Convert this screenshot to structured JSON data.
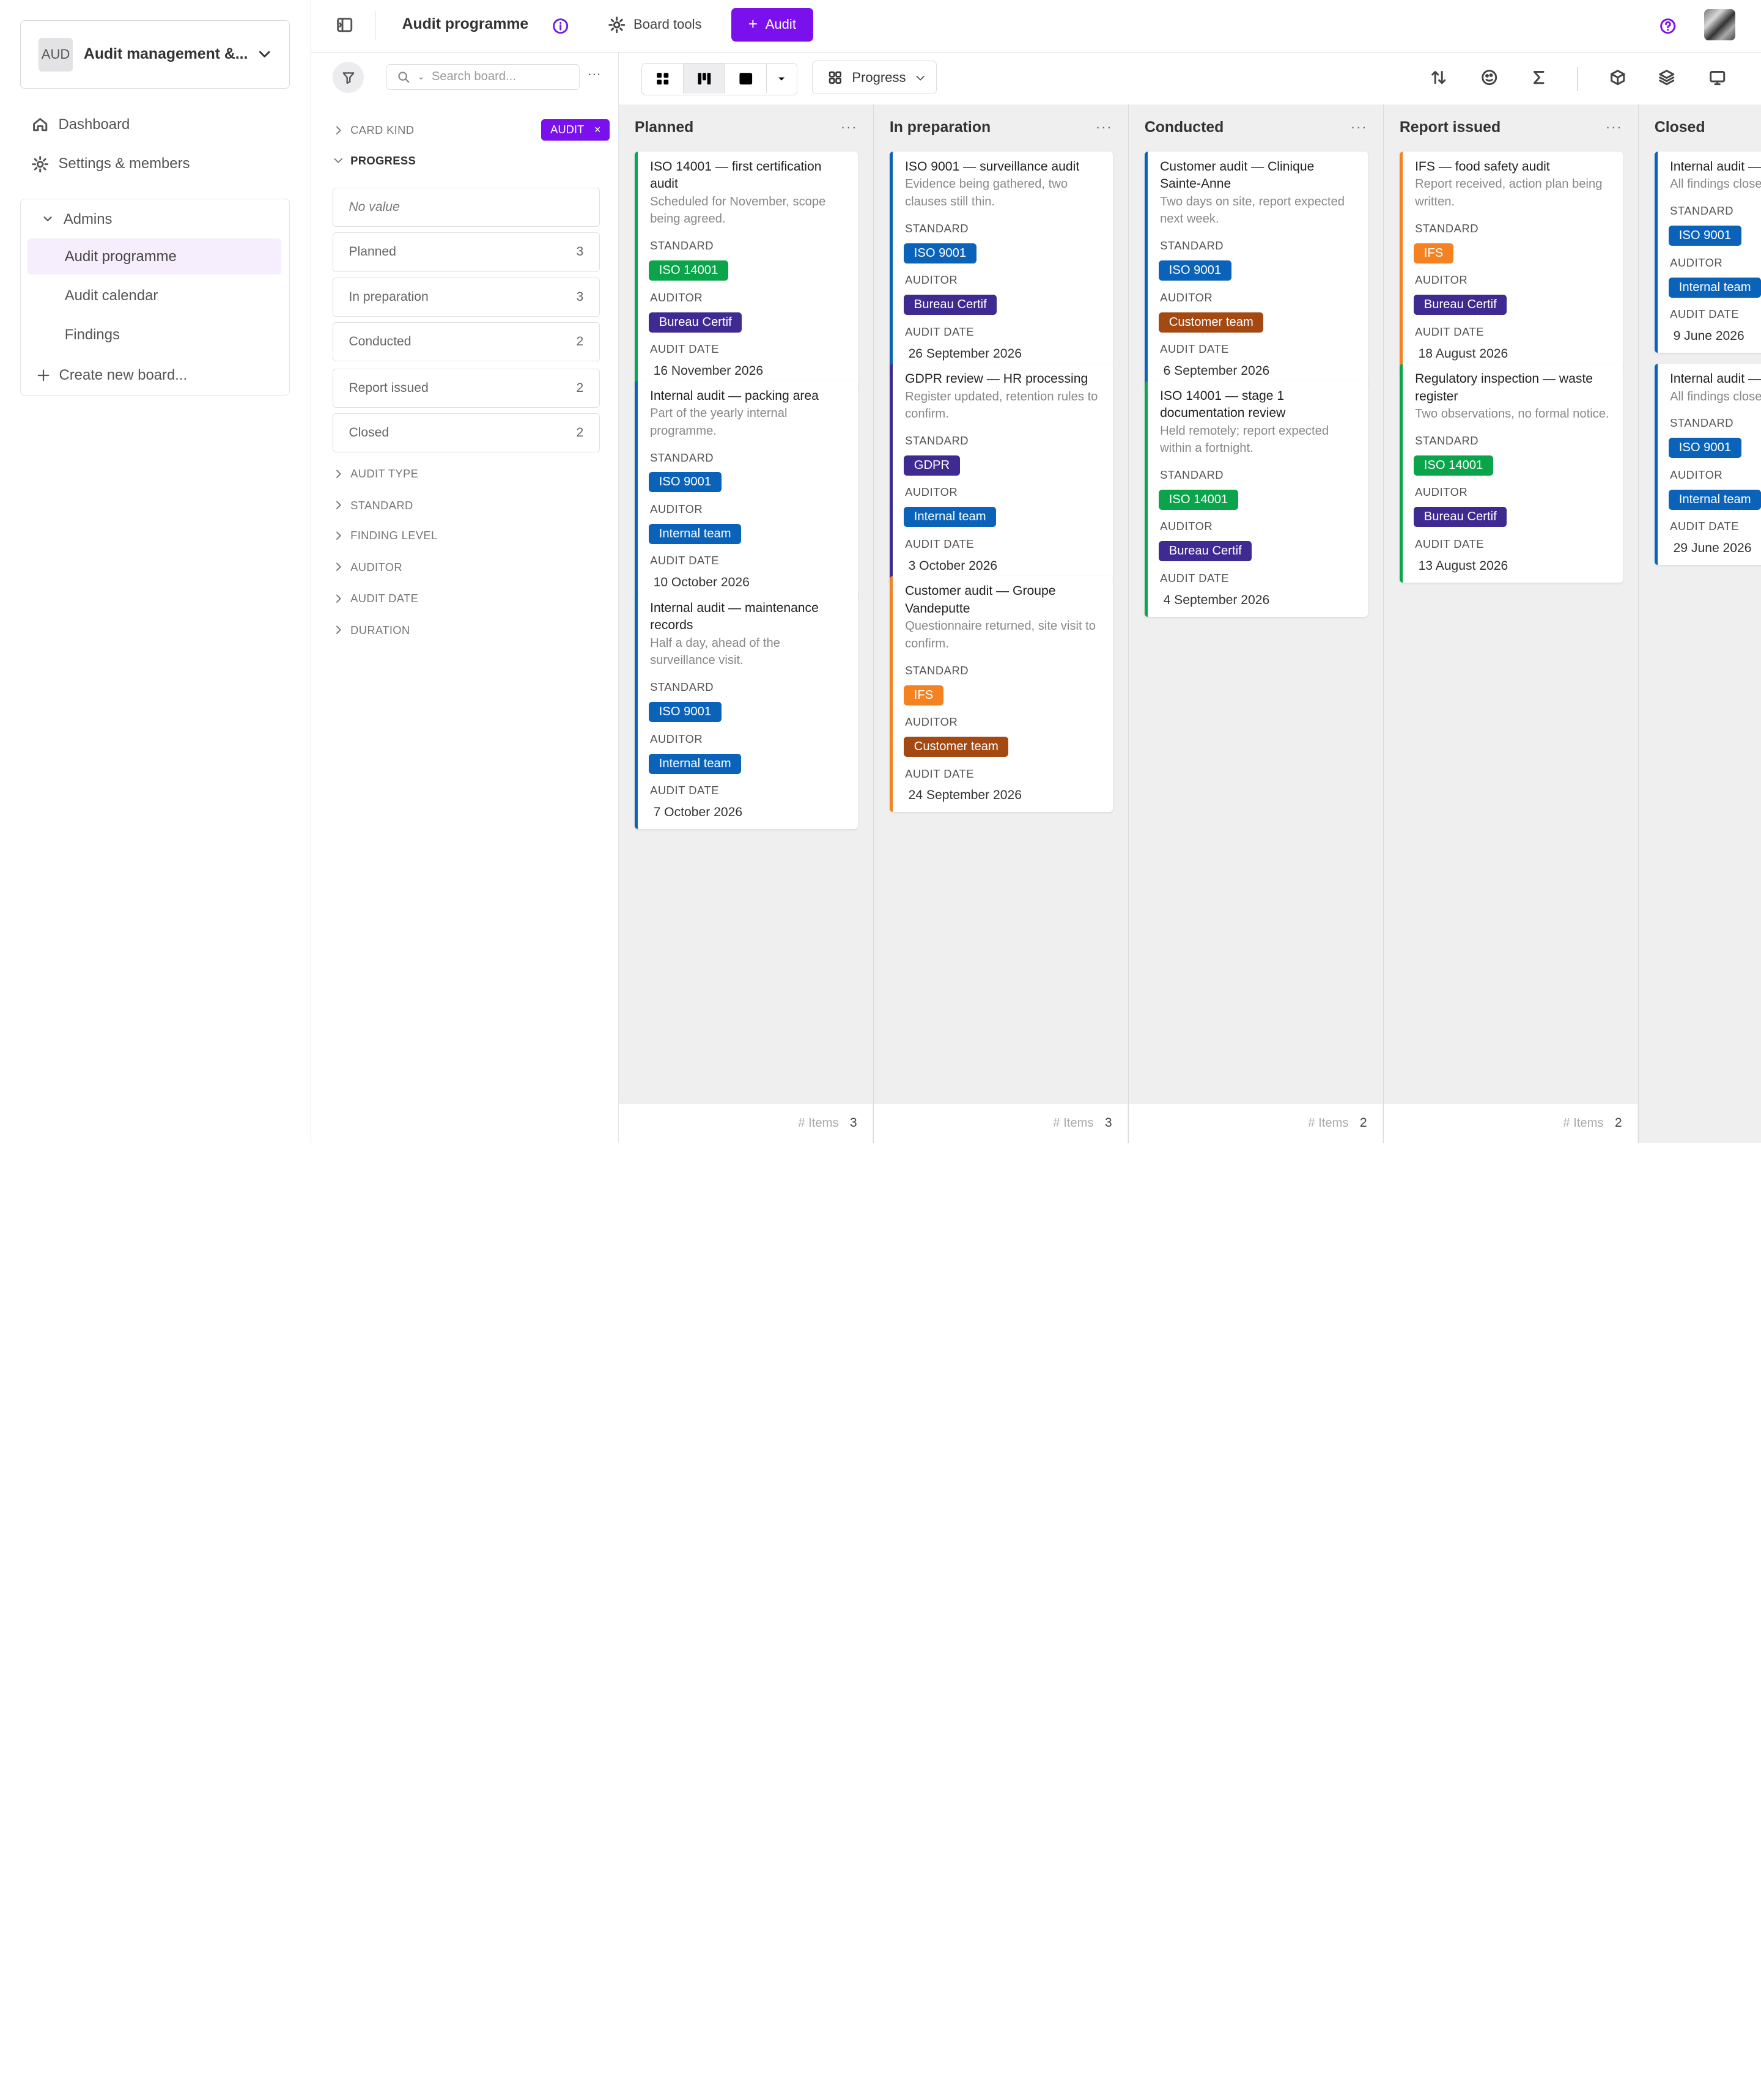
{
  "workspace": {
    "avatar": "AUD",
    "name": "Audit management &..."
  },
  "nav": {
    "dashboard": "Dashboard",
    "settings": "Settings & members"
  },
  "group": {
    "name": "Admins",
    "boards": [
      "Audit programme",
      "Audit calendar",
      "Findings"
    ],
    "create": "Create new board..."
  },
  "topbar": {
    "title": "Audit programme",
    "tools": "Board tools",
    "new_button": "Audit"
  },
  "filters": {
    "search_placeholder": "Search board...",
    "card_kind": "CARD KIND",
    "card_kind_chip": "AUDIT",
    "progress": "PROGRESS",
    "options": [
      {
        "label": "No value",
        "count": ""
      },
      {
        "label": "Planned",
        "count": "3"
      },
      {
        "label": "In preparation",
        "count": "3"
      },
      {
        "label": "Conducted",
        "count": "2"
      },
      {
        "label": "Report issued",
        "count": "2"
      },
      {
        "label": "Closed",
        "count": "2"
      }
    ],
    "sections": [
      "AUDIT TYPE",
      "STANDARD",
      "FINDING LEVEL",
      "AUDITOR",
      "AUDIT DATE",
      "DURATION"
    ]
  },
  "viewbar": {
    "group_by": "Progress"
  },
  "labels": {
    "standard": "STANDARD",
    "auditor": "AUDITOR",
    "audit_date": "AUDIT DATE",
    "items": "# Items"
  },
  "columns": [
    {
      "title": "Planned",
      "count": "3",
      "cards": [
        {
          "title": "ISO 14001 — first certification audit",
          "desc": "Scheduled for November, scope being agreed.",
          "standard": "ISO 14001",
          "auditor": "Bureau Certif",
          "date": "16 November 2026",
          "accent": "#0aa54b"
        },
        {
          "title": "Internal audit — packing area",
          "desc": "Part of the yearly internal programme.",
          "standard": "ISO 9001",
          "auditor": "Internal team",
          "date": "10 October 2026",
          "accent": "#0a63b8"
        },
        {
          "title": "Internal audit — maintenance records",
          "desc": "Half a day, ahead of the surveillance visit.",
          "standard": "ISO 9001",
          "auditor": "Internal team",
          "date": "7 October 2026",
          "accent": "#0a63b8"
        }
      ]
    },
    {
      "title": "In preparation",
      "count": "3",
      "cards": [
        {
          "title": "ISO 9001 — surveillance audit",
          "desc": "Evidence being gathered, two clauses still thin.",
          "standard": "ISO 9001",
          "auditor": "Bureau Certif",
          "date": "26 September 2026",
          "accent": "#0a63b8"
        },
        {
          "title": "GDPR review — HR processing",
          "desc": "Register updated, retention rules to confirm.",
          "standard": "GDPR",
          "auditor": "Internal team",
          "date": "3 October 2026",
          "accent": "#3e2a90"
        },
        {
          "title": "Customer audit — Groupe Vandeputte",
          "desc": "Questionnaire returned, site visit to confirm.",
          "standard": "IFS",
          "auditor": "Customer team",
          "date": "24 September 2026",
          "accent": "#f58220"
        }
      ]
    },
    {
      "title": "Conducted",
      "count": "2",
      "cards": [
        {
          "title": "Customer audit — Clinique Sainte-Anne",
          "desc": "Two days on site, report expected next week.",
          "standard": "ISO 9001",
          "auditor": "Customer team",
          "date": "6 September 2026",
          "accent": "#0a63b8"
        },
        {
          "title": "ISO 14001 — stage 1 documentation review",
          "desc": "Held remotely; report expected within a fortnight.",
          "standard": "ISO 14001",
          "auditor": "Bureau Certif",
          "date": "4 September 2026",
          "accent": "#0aa54b"
        }
      ]
    },
    {
      "title": "Report issued",
      "count": "2",
      "cards": [
        {
          "title": "IFS — food safety audit",
          "desc": "Report received, action plan being written.",
          "standard": "IFS",
          "auditor": "Bureau Certif",
          "date": "18 August 2026",
          "accent": "#f58220"
        },
        {
          "title": "Regulatory inspection — waste register",
          "desc": "Two observations, no formal notice.",
          "standard": "ISO 14001",
          "auditor": "Bureau Certif",
          "date": "13 August 2026",
          "accent": "#0aa54b"
        }
      ]
    },
    {
      "title": "Closed",
      "count": "2",
      "cards": [
        {
          "title": "Internal audit — inspection",
          "desc": "All findings close",
          "standard": "ISO 9001",
          "auditor": "Internal team",
          "date": "9 June 2026",
          "accent": "#0a63b8"
        },
        {
          "title": "Internal audit — control",
          "desc": "All findings close",
          "standard": "ISO 9001",
          "auditor": "Internal team",
          "date": "29 June 2026",
          "accent": "#0a63b8"
        }
      ]
    }
  ]
}
